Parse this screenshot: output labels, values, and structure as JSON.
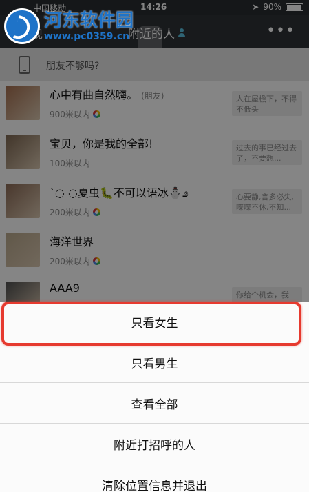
{
  "status_bar": {
    "carrier": "中国移动",
    "time": "14:26",
    "battery": "90%",
    "battery_level": 0.9
  },
  "watermark": {
    "name": "河东软件园",
    "url": "www.pc0359.cn"
  },
  "nav": {
    "back_label": "现",
    "title": "附近的人",
    "more_label": "•••"
  },
  "friends_bar": {
    "label": "朋友不够吗?"
  },
  "people": [
    {
      "name": "心中有曲自然嗨。",
      "tag": "(朋友)",
      "distance": "900米以内",
      "has_moments": true,
      "signature": "人在屋檐下，不得不低头",
      "avatar_color": "#a66f4f"
    },
    {
      "name": "宝贝，你是我的全部!",
      "tag": "",
      "distance": "100米以内",
      "has_moments": false,
      "signature": "过去的事已经过去了，不要想...",
      "avatar_color": "#7d6650"
    },
    {
      "name": "`◌ ◌夏虫🐛不可以语冰⛄೨",
      "tag": "",
      "distance": "200米以内",
      "has_moments": true,
      "signature": "心要静,言多必失,喋喋不休,不知...",
      "avatar_color": "#8c6a55"
    },
    {
      "name": "海洋世界",
      "tag": "",
      "distance": "200米以内",
      "has_moments": true,
      "signature": "",
      "avatar_color": "#b9a88c"
    },
    {
      "name": "AAA9",
      "tag": "",
      "distance": "",
      "has_moments": false,
      "signature": "你给个机会，我",
      "avatar_color": "#4f4f4f"
    }
  ],
  "action_sheet": {
    "items": [
      {
        "label": "只看女生",
        "highlighted": true
      },
      {
        "label": "只看男生",
        "highlighted": false
      },
      {
        "label": "查看全部",
        "highlighted": false
      },
      {
        "label": "附近打招呼的人",
        "highlighted": false
      },
      {
        "label": "清除位置信息并退出",
        "highlighted": false
      }
    ],
    "highlight_color": "#e63a2f"
  }
}
